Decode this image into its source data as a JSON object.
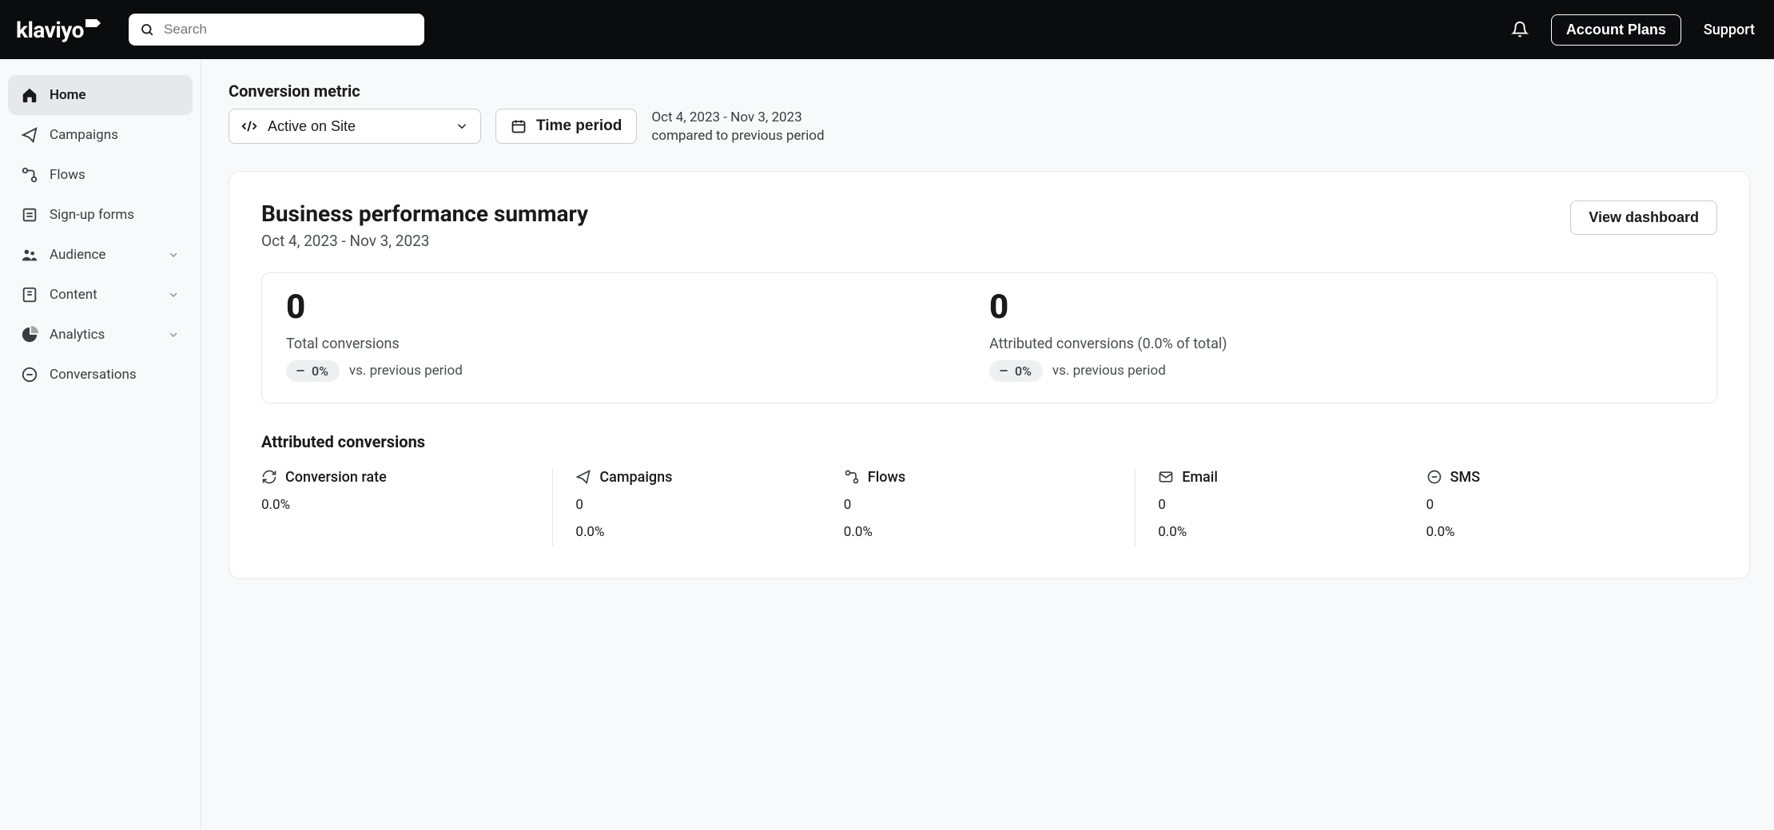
{
  "header": {
    "logo_text": "klaviyo",
    "search_placeholder": "Search",
    "account_plans_label": "Account Plans",
    "support_label": "Support"
  },
  "sidebar": {
    "items": [
      {
        "label": "Home"
      },
      {
        "label": "Campaigns"
      },
      {
        "label": "Flows"
      },
      {
        "label": "Sign-up forms"
      },
      {
        "label": "Audience"
      },
      {
        "label": "Content"
      },
      {
        "label": "Analytics"
      },
      {
        "label": "Conversations"
      }
    ]
  },
  "filters": {
    "conversion_metric_label": "Conversion metric",
    "conversion_metric_value": "Active on Site",
    "time_period_label": "Time period",
    "period_range": "Oct 4, 2023 - Nov 3, 2023",
    "period_compare": "compared to previous period"
  },
  "summary": {
    "title": "Business performance summary",
    "subtitle": "Oct 4, 2023 - Nov 3, 2023",
    "view_dashboard_label": "View dashboard",
    "totals": {
      "total_conversions": {
        "value": "0",
        "label": "Total conversions",
        "delta": "0%",
        "vs": "vs. previous period"
      },
      "attributed_conversions": {
        "value": "0",
        "label": "Attributed conversions (0.0% of total)",
        "delta": "0%",
        "vs": "vs. previous period"
      }
    },
    "attributed_heading": "Attributed conversions",
    "cols": [
      {
        "name": "conversion-rate",
        "label": "Conversion rate",
        "val1": "0.0%",
        "val2": ""
      },
      {
        "name": "campaigns",
        "label": "Campaigns",
        "val1": "0",
        "val2": "0.0%"
      },
      {
        "name": "flows",
        "label": "Flows",
        "val1": "0",
        "val2": "0.0%"
      },
      {
        "name": "email",
        "label": "Email",
        "val1": "0",
        "val2": "0.0%"
      },
      {
        "name": "sms",
        "label": "SMS",
        "val1": "0",
        "val2": "0.0%"
      }
    ]
  }
}
